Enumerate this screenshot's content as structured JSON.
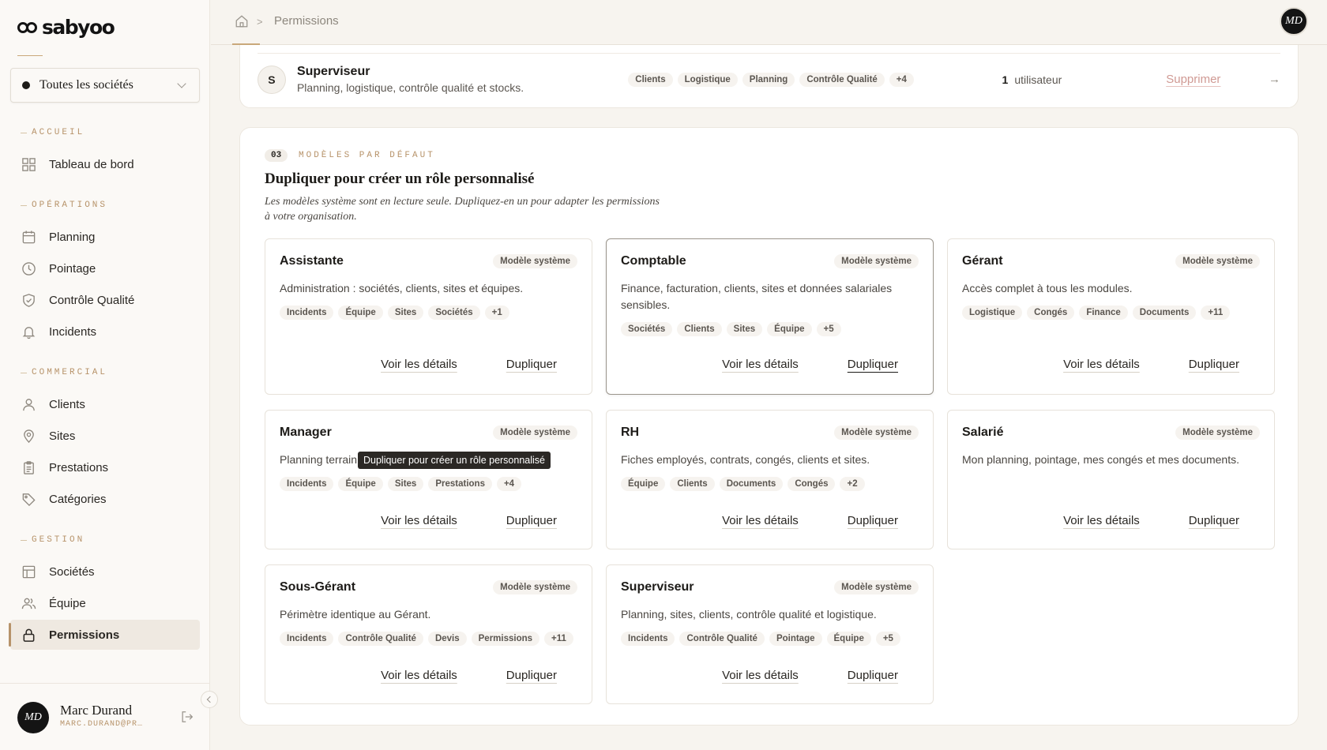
{
  "app": {
    "logo_text": "sabyoo"
  },
  "company_select": {
    "value": "Toutes les sociétés"
  },
  "sidebar": {
    "sections": {
      "accueil": "ACCUEIL",
      "operations": "OPÉRATIONS",
      "commercial": "COMMERCIAL",
      "gestion": "GESTION"
    },
    "items": {
      "dashboard": "Tableau de bord",
      "planning": "Planning",
      "pointage": "Pointage",
      "controle": "Contrôle Qualité",
      "incidents": "Incidents",
      "clients": "Clients",
      "sites": "Sites",
      "prestations": "Prestations",
      "categories": "Catégories",
      "societes": "Sociétés",
      "equipe": "Équipe",
      "permissions": "Permissions"
    }
  },
  "user": {
    "initials": "MD",
    "name": "Marc Durand",
    "email": "MARC.DURAND@PR…"
  },
  "breadcrumb": {
    "current": "Permissions",
    "separator": ">"
  },
  "role_row": {
    "initial": "S",
    "name": "Superviseur",
    "description": "Planning, logistique, contrôle qualité et stocks.",
    "tags": [
      "Clients",
      "Logistique",
      "Planning",
      "Contrôle Qualité",
      "+4"
    ],
    "user_count": "1",
    "user_label": "utilisateur",
    "delete_label": "Supprimer",
    "arrow": "→"
  },
  "templates_section": {
    "number": "03",
    "label": "MODÈLES PAR DÉFAUT",
    "title": "Dupliquer pour créer un rôle personnalisé",
    "description": "Les modèles système sont en lecture seule. Dupliquez-en un pour adapter les permissions à votre organisation.",
    "badge": "Modèle système",
    "details_label": "Voir les détails",
    "duplicate_label": "Dupliquer",
    "tooltip": "Dupliquer pour créer un rôle personnalisé",
    "cards": [
      {
        "name": "Assistante",
        "description": "Administration : sociétés, clients, sites et équipes.",
        "tags": [
          "Incidents",
          "Équipe",
          "Sites",
          "Sociétés",
          "+1"
        ]
      },
      {
        "name": "Comptable",
        "description": "Finance, facturation, clients, sites et données salariales sensibles.",
        "tags": [
          "Sociétés",
          "Clients",
          "Sites",
          "Équipe",
          "+5"
        ]
      },
      {
        "name": "Gérant",
        "description": "Accès complet à tous les modules.",
        "tags": [
          "Logistique",
          "Congés",
          "Finance",
          "Documents",
          "+11"
        ]
      },
      {
        "name": "Manager",
        "description": "Planning terrain",
        "tags": [
          "Incidents",
          "Équipe",
          "Sites",
          "Prestations",
          "+4"
        ]
      },
      {
        "name": "RH",
        "description": "Fiches employés, contrats, congés, clients et sites.",
        "tags": [
          "Équipe",
          "Clients",
          "Documents",
          "Congés",
          "+2"
        ]
      },
      {
        "name": "Salarié",
        "description": "Mon planning, pointage, mes congés et mes documents.",
        "tags": []
      },
      {
        "name": "Sous-Gérant",
        "description": "Périmètre identique au Gérant.",
        "tags": [
          "Incidents",
          "Contrôle Qualité",
          "Devis",
          "Permissions",
          "+11"
        ]
      },
      {
        "name": "Superviseur",
        "description": "Planning, sites, clients, contrôle qualité et logistique.",
        "tags": [
          "Incidents",
          "Contrôle Qualité",
          "Pointage",
          "Équipe",
          "+5"
        ]
      }
    ]
  },
  "colors": {
    "accent": "#b7936a",
    "background": "#f7f4ef",
    "danger_link": "#d09a94"
  },
  "icons": [
    "home-icon",
    "grid-icon",
    "calendar-icon",
    "clock-icon",
    "shield-check-icon",
    "bell-icon",
    "user-icon",
    "map-pin-icon",
    "clipboard-icon",
    "tag-icon",
    "building-icon",
    "users-icon",
    "lock-icon",
    "logout-icon",
    "chevron-down-icon",
    "chevron-left-icon",
    "arrow-right-icon"
  ]
}
